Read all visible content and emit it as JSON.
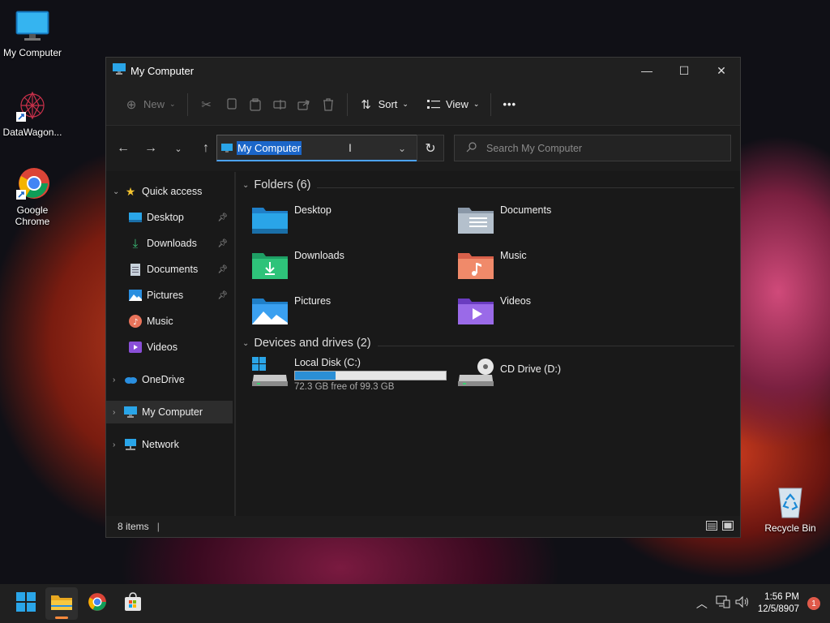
{
  "desktop": {
    "icons": [
      {
        "label": "My Computer"
      },
      {
        "label": "DataWagon..."
      },
      {
        "label": "Google Chrome"
      },
      {
        "label": "Recycle Bin"
      }
    ]
  },
  "window": {
    "title": "My Computer",
    "controls": {
      "minimize": "—",
      "maximize": "☐",
      "close": "✕"
    }
  },
  "toolbar": {
    "new_label": "New",
    "sort_label": "Sort",
    "view_label": "View",
    "more_label": "•••"
  },
  "address": {
    "value": "My Computer",
    "search_placeholder": "Search My Computer"
  },
  "nav_pane": {
    "quick_access": "Quick access",
    "items": [
      {
        "label": "Desktop",
        "pinned": true
      },
      {
        "label": "Downloads",
        "pinned": true
      },
      {
        "label": "Documents",
        "pinned": true
      },
      {
        "label": "Pictures",
        "pinned": true
      },
      {
        "label": "Music",
        "pinned": false
      },
      {
        "label": "Videos",
        "pinned": false
      }
    ],
    "onedrive": "OneDrive",
    "my_computer": "My Computer",
    "network": "Network"
  },
  "content": {
    "folders_header": "Folders (6)",
    "folders": [
      {
        "label": "Desktop",
        "icon": "desktop-folder-icon"
      },
      {
        "label": "Documents",
        "icon": "documents-folder-icon"
      },
      {
        "label": "Downloads",
        "icon": "downloads-folder-icon"
      },
      {
        "label": "Music",
        "icon": "music-folder-icon"
      },
      {
        "label": "Pictures",
        "icon": "pictures-folder-icon"
      },
      {
        "label": "Videos",
        "icon": "videos-folder-icon"
      }
    ],
    "drives_header": "Devices and drives (2)",
    "drives": [
      {
        "label": "Local Disk (C:)",
        "free_text": "72.3 GB free of 99.3 GB",
        "used_fraction": 0.27
      },
      {
        "label": "CD Drive (D:)"
      }
    ]
  },
  "status": {
    "items": "8 items"
  },
  "taskbar": {
    "time": "1:56 PM",
    "date": "12/5/8907",
    "notifications": "1"
  },
  "colors": {
    "accent": "#1b66c9",
    "progress": "#2b8fd6"
  }
}
